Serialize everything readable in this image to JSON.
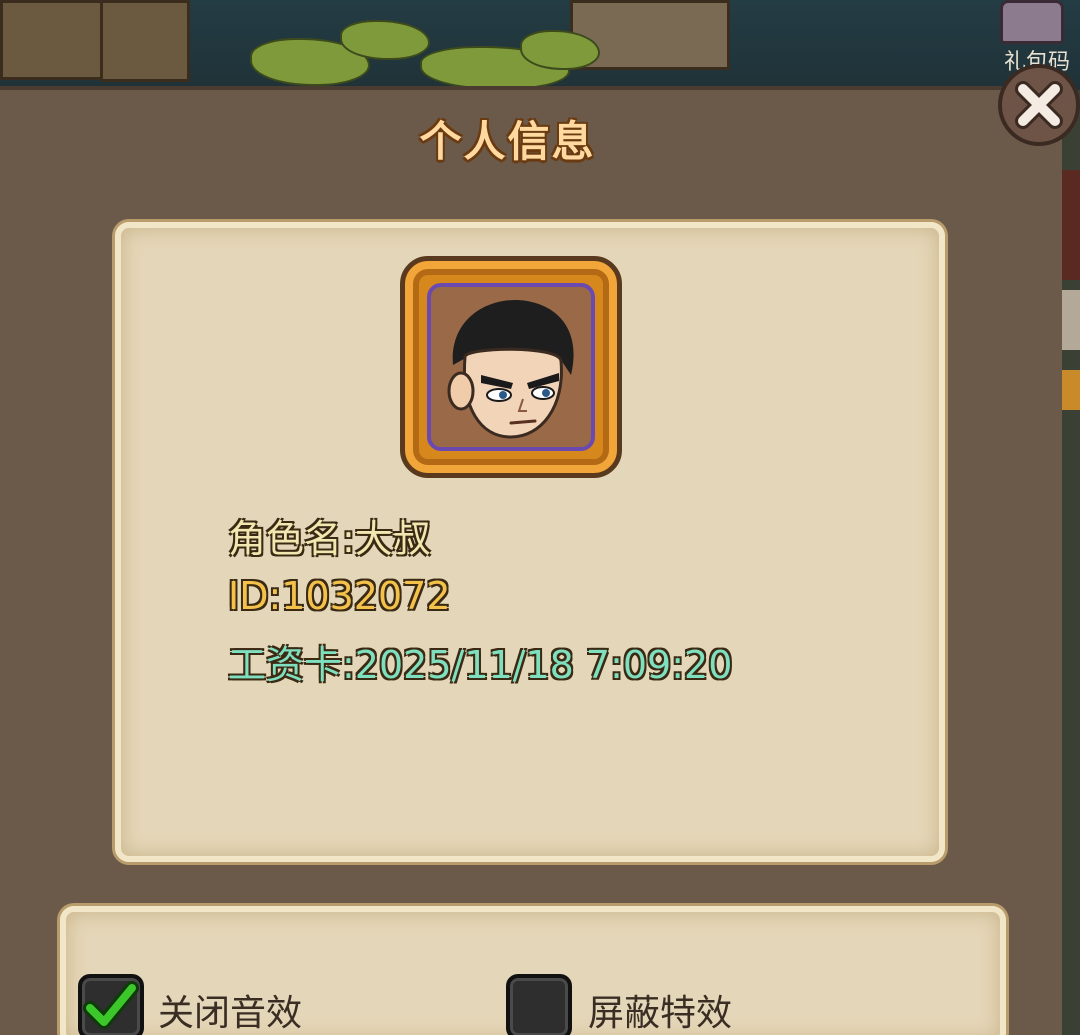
{
  "background": {
    "chest_label": "礼包码"
  },
  "dialog": {
    "title": "个人信息",
    "close_icon": "close-x-icon"
  },
  "profile": {
    "name_line": "角色名:大叔",
    "id_line": "ID:1032072",
    "card_line": "工资卡:2025/11/18 7:09:20",
    "avatar": "character-portrait"
  },
  "settings": {
    "mute_sound": {
      "label": "关闭音效",
      "checked": true
    },
    "hide_effects": {
      "label": "屏蔽特效",
      "checked": false
    }
  },
  "colors": {
    "title": "#ffd9a0",
    "name": "#f0e8b0",
    "id": "#f4c24a",
    "card": "#7fe0c0",
    "panel": "#e4d6b8",
    "dialog": "#6b5a4a",
    "check": "#3cc82a"
  }
}
